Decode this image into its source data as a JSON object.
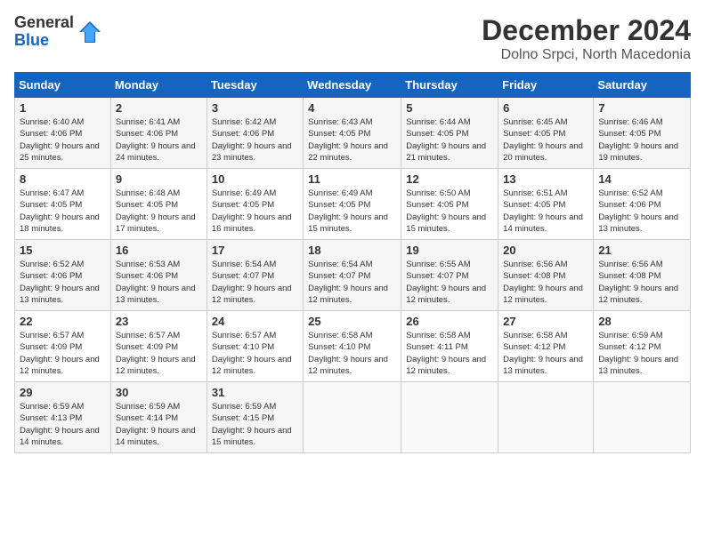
{
  "logo": {
    "general": "General",
    "blue": "Blue"
  },
  "header": {
    "month": "December 2024",
    "location": "Dolno Srpci, North Macedonia"
  },
  "weekdays": [
    "Sunday",
    "Monday",
    "Tuesday",
    "Wednesday",
    "Thursday",
    "Friday",
    "Saturday"
  ],
  "weeks": [
    [
      {
        "day": "1",
        "sunrise": "6:40 AM",
        "sunset": "4:06 PM",
        "daylight": "9 hours and 25 minutes."
      },
      {
        "day": "2",
        "sunrise": "6:41 AM",
        "sunset": "4:06 PM",
        "daylight": "9 hours and 24 minutes."
      },
      {
        "day": "3",
        "sunrise": "6:42 AM",
        "sunset": "4:06 PM",
        "daylight": "9 hours and 23 minutes."
      },
      {
        "day": "4",
        "sunrise": "6:43 AM",
        "sunset": "4:05 PM",
        "daylight": "9 hours and 22 minutes."
      },
      {
        "day": "5",
        "sunrise": "6:44 AM",
        "sunset": "4:05 PM",
        "daylight": "9 hours and 21 minutes."
      },
      {
        "day": "6",
        "sunrise": "6:45 AM",
        "sunset": "4:05 PM",
        "daylight": "9 hours and 20 minutes."
      },
      {
        "day": "7",
        "sunrise": "6:46 AM",
        "sunset": "4:05 PM",
        "daylight": "9 hours and 19 minutes."
      }
    ],
    [
      {
        "day": "8",
        "sunrise": "6:47 AM",
        "sunset": "4:05 PM",
        "daylight": "9 hours and 18 minutes."
      },
      {
        "day": "9",
        "sunrise": "6:48 AM",
        "sunset": "4:05 PM",
        "daylight": "9 hours and 17 minutes."
      },
      {
        "day": "10",
        "sunrise": "6:49 AM",
        "sunset": "4:05 PM",
        "daylight": "9 hours and 16 minutes."
      },
      {
        "day": "11",
        "sunrise": "6:49 AM",
        "sunset": "4:05 PM",
        "daylight": "9 hours and 15 minutes."
      },
      {
        "day": "12",
        "sunrise": "6:50 AM",
        "sunset": "4:05 PM",
        "daylight": "9 hours and 15 minutes."
      },
      {
        "day": "13",
        "sunrise": "6:51 AM",
        "sunset": "4:05 PM",
        "daylight": "9 hours and 14 minutes."
      },
      {
        "day": "14",
        "sunrise": "6:52 AM",
        "sunset": "4:06 PM",
        "daylight": "9 hours and 13 minutes."
      }
    ],
    [
      {
        "day": "15",
        "sunrise": "6:52 AM",
        "sunset": "4:06 PM",
        "daylight": "9 hours and 13 minutes."
      },
      {
        "day": "16",
        "sunrise": "6:53 AM",
        "sunset": "4:06 PM",
        "daylight": "9 hours and 13 minutes."
      },
      {
        "day": "17",
        "sunrise": "6:54 AM",
        "sunset": "4:07 PM",
        "daylight": "9 hours and 12 minutes."
      },
      {
        "day": "18",
        "sunrise": "6:54 AM",
        "sunset": "4:07 PM",
        "daylight": "9 hours and 12 minutes."
      },
      {
        "day": "19",
        "sunrise": "6:55 AM",
        "sunset": "4:07 PM",
        "daylight": "9 hours and 12 minutes."
      },
      {
        "day": "20",
        "sunrise": "6:56 AM",
        "sunset": "4:08 PM",
        "daylight": "9 hours and 12 minutes."
      },
      {
        "day": "21",
        "sunrise": "6:56 AM",
        "sunset": "4:08 PM",
        "daylight": "9 hours and 12 minutes."
      }
    ],
    [
      {
        "day": "22",
        "sunrise": "6:57 AM",
        "sunset": "4:09 PM",
        "daylight": "9 hours and 12 minutes."
      },
      {
        "day": "23",
        "sunrise": "6:57 AM",
        "sunset": "4:09 PM",
        "daylight": "9 hours and 12 minutes."
      },
      {
        "day": "24",
        "sunrise": "6:57 AM",
        "sunset": "4:10 PM",
        "daylight": "9 hours and 12 minutes."
      },
      {
        "day": "25",
        "sunrise": "6:58 AM",
        "sunset": "4:10 PM",
        "daylight": "9 hours and 12 minutes."
      },
      {
        "day": "26",
        "sunrise": "6:58 AM",
        "sunset": "4:11 PM",
        "daylight": "9 hours and 12 minutes."
      },
      {
        "day": "27",
        "sunrise": "6:58 AM",
        "sunset": "4:12 PM",
        "daylight": "9 hours and 13 minutes."
      },
      {
        "day": "28",
        "sunrise": "6:59 AM",
        "sunset": "4:12 PM",
        "daylight": "9 hours and 13 minutes."
      }
    ],
    [
      {
        "day": "29",
        "sunrise": "6:59 AM",
        "sunset": "4:13 PM",
        "daylight": "9 hours and 14 minutes."
      },
      {
        "day": "30",
        "sunrise": "6:59 AM",
        "sunset": "4:14 PM",
        "daylight": "9 hours and 14 minutes."
      },
      {
        "day": "31",
        "sunrise": "6:59 AM",
        "sunset": "4:15 PM",
        "daylight": "9 hours and 15 minutes."
      },
      null,
      null,
      null,
      null
    ]
  ]
}
